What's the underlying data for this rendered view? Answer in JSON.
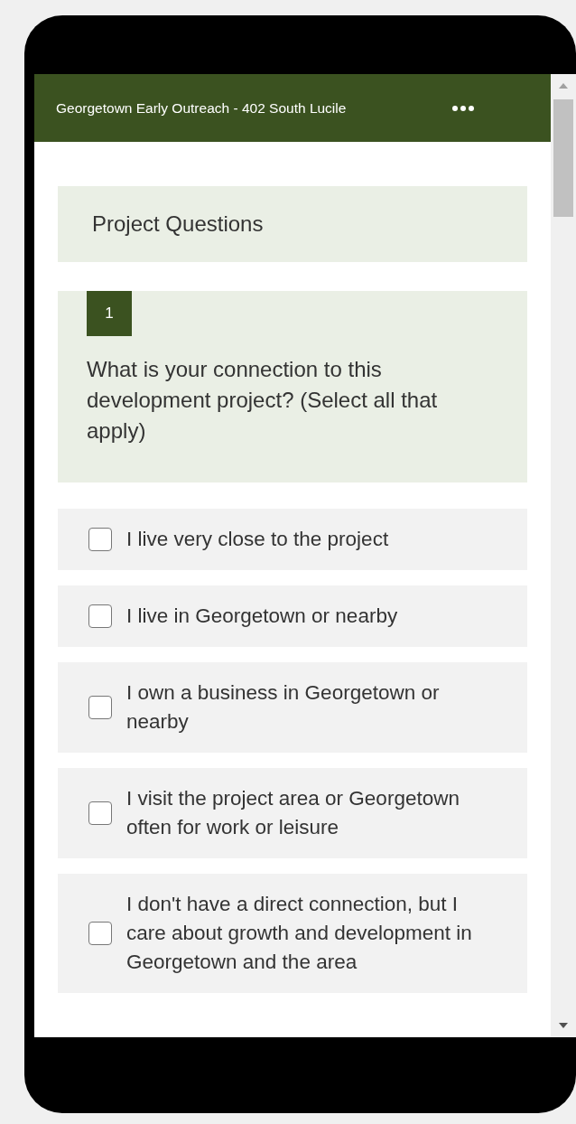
{
  "header": {
    "title": "Georgetown Early Outreach - 402 South Lucile"
  },
  "section": {
    "title": "Project Questions"
  },
  "question": {
    "number": "1",
    "text": "What is your connection to this development project? (Select all that apply)",
    "options": [
      {
        "label": "I live very close to the project",
        "checked": false
      },
      {
        "label": "I live in Georgetown or nearby",
        "checked": false
      },
      {
        "label": "I own a business in Georgetown or nearby",
        "checked": false
      },
      {
        "label": "I visit the project area or Georgetown often for work or leisure",
        "checked": false
      },
      {
        "label": "I don't have a direct connection, but I care about growth and development in Georgetown and the area",
        "checked": false
      }
    ]
  }
}
